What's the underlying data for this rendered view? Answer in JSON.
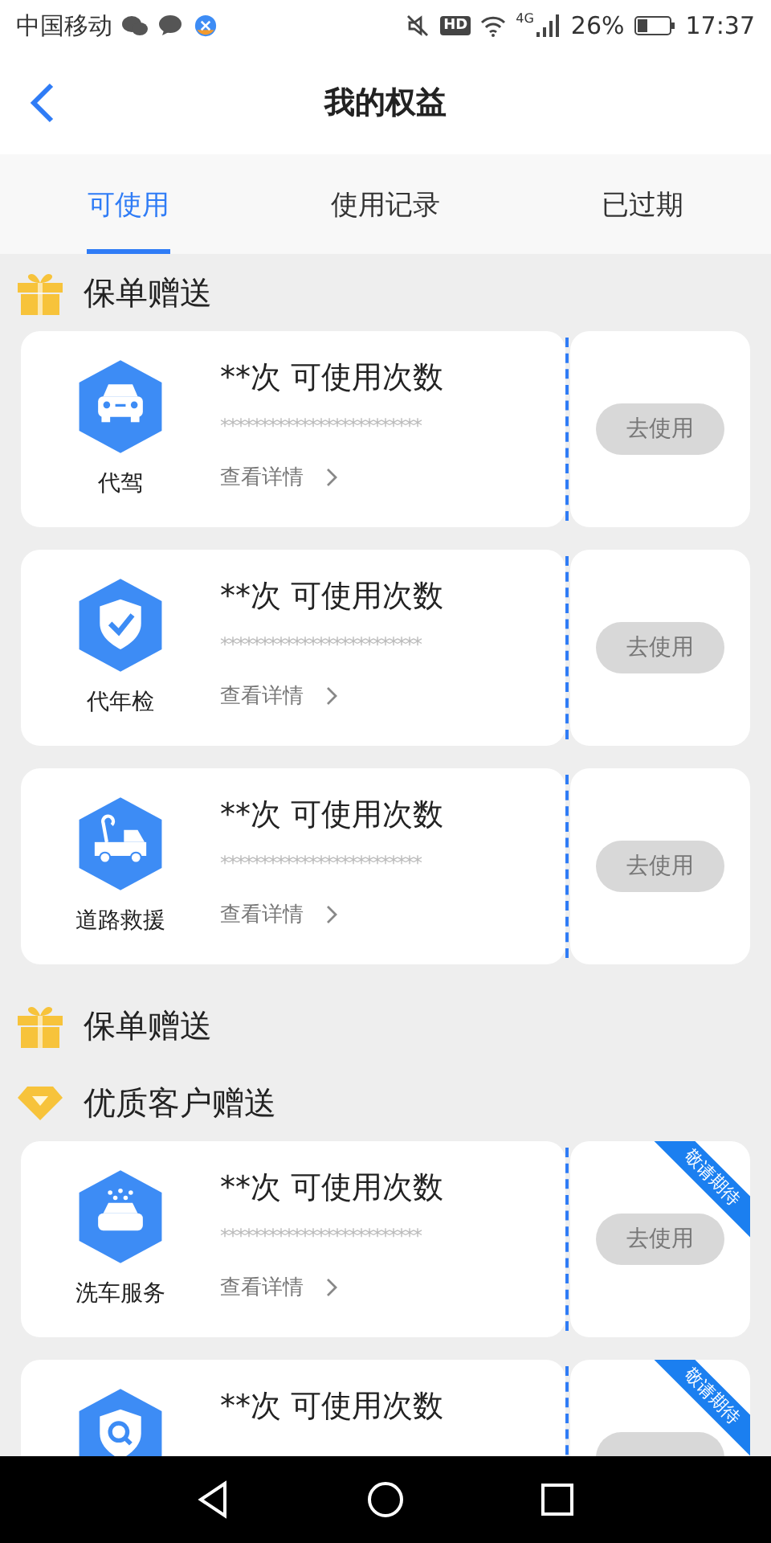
{
  "status_bar": {
    "carrier": "中国移动",
    "hd": "HD",
    "network": "4G",
    "battery": "26%",
    "time": "17:37"
  },
  "header": {
    "title": "我的权益"
  },
  "tabs": [
    {
      "label": "可使用",
      "selected": true
    },
    {
      "label": "使用记录",
      "selected": false
    },
    {
      "label": "已过期",
      "selected": false
    }
  ],
  "sections": [
    {
      "title": "保单赠送",
      "kind": "gift",
      "cards": [
        {
          "service": "代驾",
          "kind": "car",
          "count": "**次 可使用次数",
          "code": "*************************",
          "details": "查看详情",
          "action": "去使用",
          "disabled": true
        },
        {
          "service": "代年检",
          "kind": "shield-check",
          "count": "**次 可使用次数",
          "code": "*************************",
          "details": "查看详情",
          "action": "去使用",
          "disabled": true
        },
        {
          "service": "道路救援",
          "kind": "tow-truck",
          "count": "**次 可使用次数",
          "code": "*************************",
          "details": "查看详情",
          "action": "去使用",
          "disabled": true
        }
      ]
    },
    {
      "title": "保单赠送",
      "kind": "gift"
    },
    {
      "title": "优质客户赠送",
      "kind": "diamond",
      "cards": [
        {
          "service": "洗车服务",
          "kind": "car-wash",
          "count": "**次 可使用次数",
          "code": "*************************",
          "details": "查看详情",
          "action": "去使用",
          "disabled": true,
          "ribbon": "敬请期待"
        },
        {
          "kind": "shield-search",
          "count": "**次 可使用次数",
          "disabled": true,
          "ribbon": "敬请期待"
        }
      ]
    }
  ]
}
